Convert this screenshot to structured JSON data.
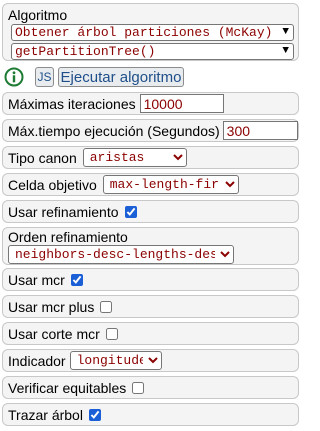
{
  "algorithm": {
    "label": "Algoritmo",
    "select_value": "Obtener árbol particiones (McKay)",
    "function_value": "getPartitionTree()"
  },
  "toolbar": {
    "info_icon": "info-circle-icon",
    "js_label": "JS",
    "run_label": "Ejecutar algoritmo"
  },
  "params": {
    "max_iterations_label": "Máximas iteraciones",
    "max_iterations_value": "10000",
    "max_time_label": "Máx.tiempo ejecución (Segundos)",
    "max_time_value": "300",
    "canon_type_label": "Tipo canon",
    "canon_type_value": "aristas",
    "target_cell_label": "Celda objetivo",
    "target_cell_value": "max-length-first",
    "use_refinement_label": "Usar refinamiento",
    "use_refinement_checked": true,
    "refinement_order_label": "Orden refinamiento",
    "refinement_order_value": "neighbors-desc-lengths-desc",
    "use_mcr_label": "Usar mcr",
    "use_mcr_checked": true,
    "use_mcr_plus_label": "Usar mcr plus",
    "use_mcr_plus_checked": false,
    "use_cut_mcr_label": "Usar corte mcr",
    "use_cut_mcr_checked": false,
    "indicator_label": "Indicador",
    "indicator_value": "longitudes",
    "check_equitable_label": "Verificar equitables",
    "check_equitable_checked": false,
    "draw_tree_label": "Trazar árbol",
    "draw_tree_checked": true
  },
  "colors": {
    "select_text": "#8b0000",
    "info_icon": "#1e7b34",
    "panel_bg": "#f4f4f4"
  }
}
